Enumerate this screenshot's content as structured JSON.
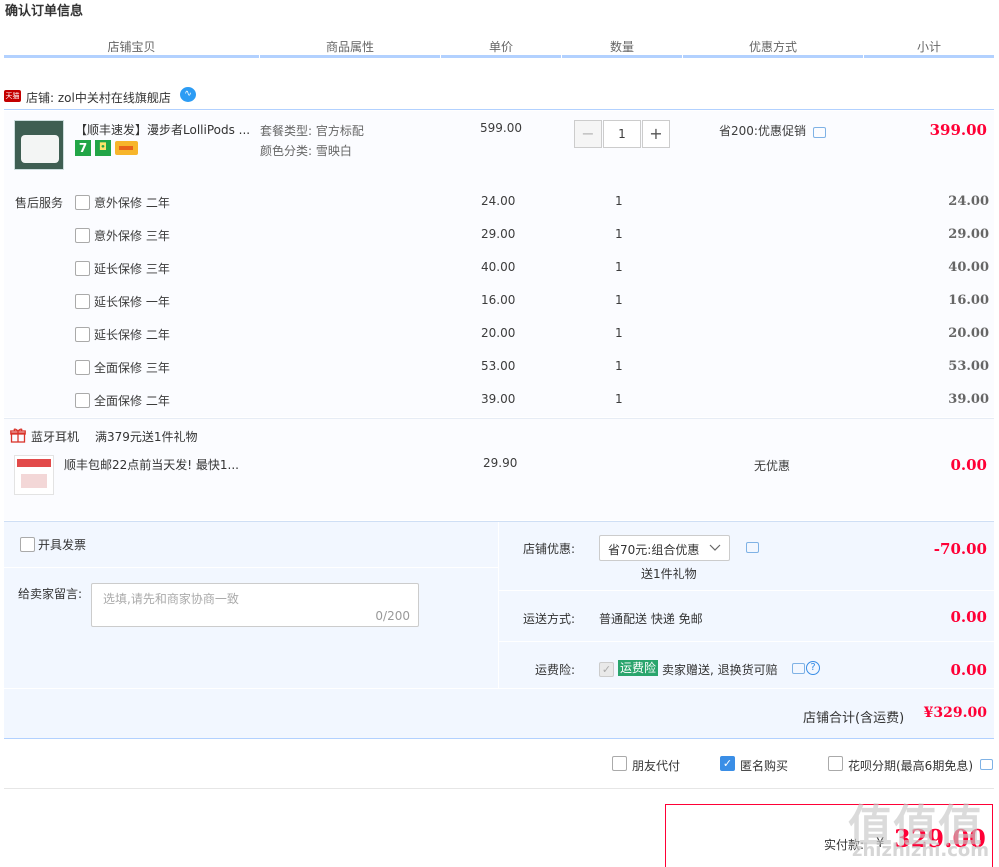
{
  "page_title": "确认订单信息",
  "columns": [
    "店铺宝贝",
    "商品属性",
    "单价",
    "数量",
    "优惠方式",
    "小计"
  ],
  "shop": {
    "badge": "天猫",
    "name": "店铺: zol中关村在线旗舰店"
  },
  "main_item": {
    "title": "【顺丰速发】漫步者LolliPods ...",
    "attr1": "套餐类型: 官方标配",
    "attr2": "颜色分类: 雪映白",
    "price": "599.00",
    "qty": "1",
    "promo": "省200:优惠促销",
    "subtotal": "399.00",
    "minus": "−",
    "plus": "+"
  },
  "service_label": "售后服务",
  "services": [
    {
      "name": "意外保修 二年",
      "price": "24.00",
      "qty": "1",
      "subtotal": "24.00"
    },
    {
      "name": "意外保修 三年",
      "price": "29.00",
      "qty": "1",
      "subtotal": "29.00"
    },
    {
      "name": "延长保修 三年",
      "price": "40.00",
      "qty": "1",
      "subtotal": "40.00"
    },
    {
      "name": "延长保修 一年",
      "price": "16.00",
      "qty": "1",
      "subtotal": "16.00"
    },
    {
      "name": "延长保修 二年",
      "price": "20.00",
      "qty": "1",
      "subtotal": "20.00"
    },
    {
      "name": "全面保修 三年",
      "price": "53.00",
      "qty": "1",
      "subtotal": "53.00"
    },
    {
      "name": "全面保修 二年",
      "price": "39.00",
      "qty": "1",
      "subtotal": "39.00"
    }
  ],
  "gift": {
    "category": "蓝牙耳机",
    "rule": "满379元送1件礼物",
    "title": "顺丰包邮22点前当天发! 最快1...",
    "price": "29.90",
    "promo": "无优惠",
    "subtotal": "0.00"
  },
  "invoice_label": "开具发票",
  "memo": {
    "label": "给卖家留言:",
    "placeholder": "选填,请先和商家协商一致",
    "counter": "0/200"
  },
  "shop_discount": {
    "label": "店铺优惠:",
    "selected": "省70元:组合优惠",
    "note": "送1件礼物",
    "amount": "-70.00"
  },
  "shipping": {
    "label": "运送方式:",
    "value": "普通配送 快递 免邮",
    "amount": "0.00"
  },
  "freight_insurance": {
    "label": "运费险:",
    "tag": "运费险",
    "text": "卖家赠送, 退换货可赔",
    "amount": "0.00",
    "help": "?"
  },
  "shop_total": {
    "label": "店铺合计(含运费)",
    "amount": "¥329.00"
  },
  "pay_options": [
    {
      "label": "朋友代付",
      "checked": false
    },
    {
      "label": "匿名购买",
      "checked": true
    },
    {
      "label": "花呗分期(最高6期免息)",
      "checked": false
    }
  ],
  "final": {
    "label": "实付款:",
    "currency": "¥",
    "amount": "329.00"
  },
  "watermark": {
    "glyphs": "值值值",
    "site": "zhizhizhi.com"
  },
  "colors": {
    "price_red": "#ff0036",
    "accent_blue": "#3a8ee6",
    "divider": "#b2d1ff"
  }
}
